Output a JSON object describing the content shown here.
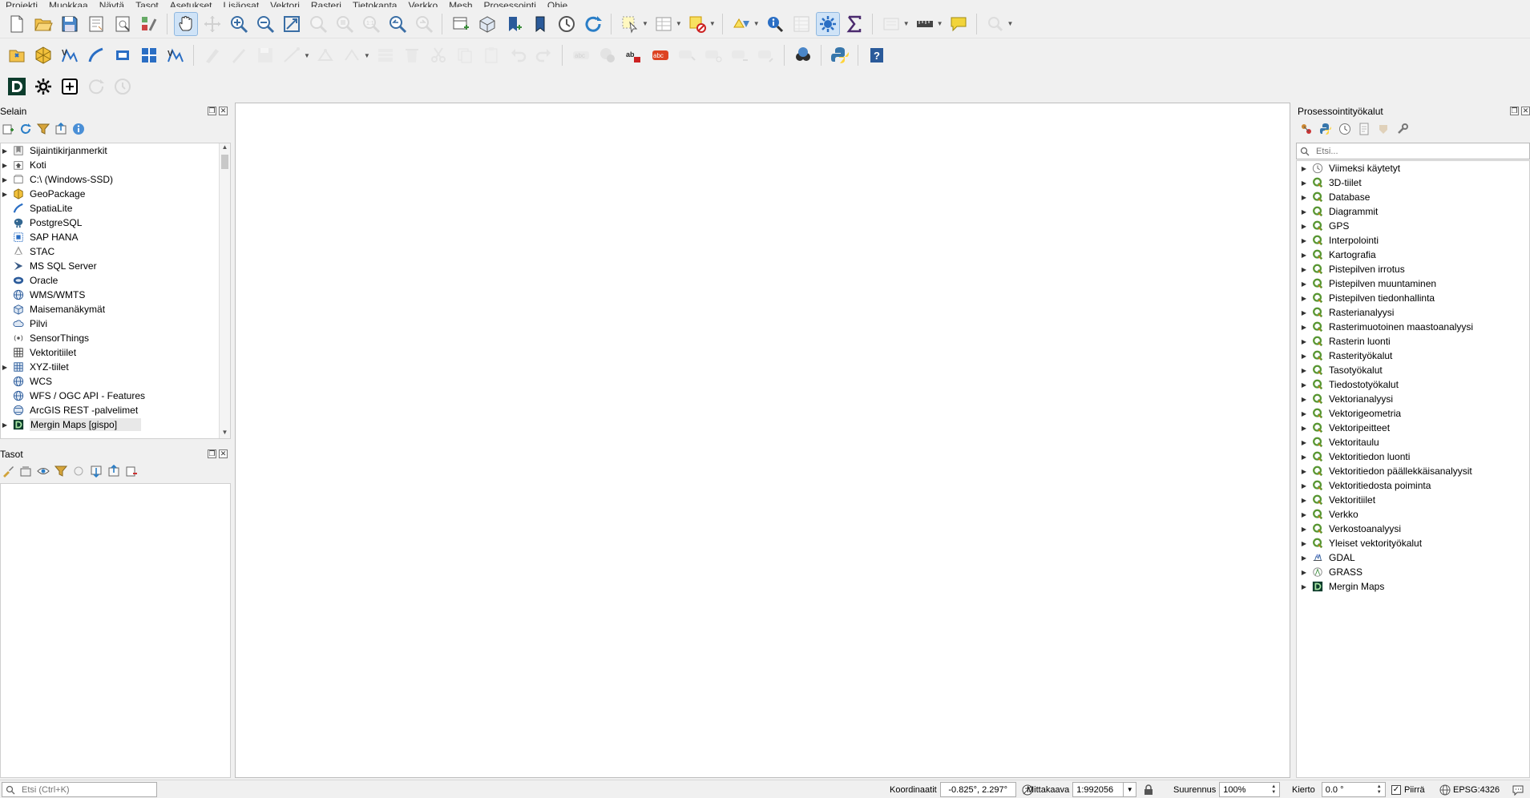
{
  "menubar": {
    "items": [
      "Projekti",
      "Muokkaa",
      "Näytä",
      "Tasot",
      "Asetukset",
      "Lisäosat",
      "Vektori",
      "Rasteri",
      "Tietokanta",
      "Verkko",
      "Mesh",
      "Prosessointi",
      "Ohje"
    ]
  },
  "toolbar1": {
    "icons": [
      "new-project-icon",
      "open-project-icon",
      "save-project-icon",
      "new-print-layout-icon",
      "layout-manager-icon",
      "style-manager-icon",
      "pan-icon",
      "pan-to-selection-icon",
      "zoom-in-icon",
      "zoom-out-icon",
      "zoom-full-icon",
      "zoom-to-selection-icon",
      "zoom-to-layer-icon",
      "zoom-native-icon",
      "zoom-last-icon",
      "zoom-next-icon",
      "new-map-view-icon",
      "new-3d-map-icon",
      "new-bookmark-icon",
      "show-bookmarks-icon",
      "temporal-controller-icon",
      "refresh-icon",
      "select-features-icon",
      "attribute-table-icon",
      "deselect-icon",
      "select-by-location-icon",
      "identify-icon",
      "statistics-icon",
      "processing-toolbox-icon",
      "sum-icon",
      "attribute-form-icon",
      "measure-icon",
      "map-tips-icon",
      "annotation-icon"
    ]
  },
  "toolbar2": {
    "icons": [
      "data-source-manager-icon",
      "new-geopackage-layer-icon",
      "new-shapefile-layer-icon",
      "new-spatialite-layer-icon",
      "new-temp-layer-icon",
      "new-virtual-layer-icon",
      "new-mesh-layer-icon",
      "digitize-icon",
      "edit-pencil-icon",
      "save-edits-icon",
      "add-feature-icon",
      "vertex-tool-icon",
      "multi-edit-icon",
      "modify-attributes-icon",
      "delete-selected-icon",
      "cut-features-icon",
      "copy-features-icon",
      "paste-features-icon",
      "undo-icon",
      "redo-icon",
      "label-toolbar-icon",
      "label-pin-icon",
      "label-highlight-icon",
      "label-show-hide-icon",
      "label-move-icon",
      "label-rotate-icon",
      "label-change-icon",
      "label-preview-icon",
      "georeferencer-icon",
      "python-console-icon",
      "help-icon"
    ]
  },
  "toolbar3": {
    "icons": [
      "mergin-maps-logo-icon",
      "settings-icon",
      "add-project-icon",
      "sync-icon",
      "history-icon"
    ]
  },
  "browser": {
    "title": "Selain",
    "items": [
      {
        "label": "Sijaintikirjanmerkit",
        "icon": "bookmarks-icon",
        "expandable": true
      },
      {
        "label": "Koti",
        "icon": "home-folder-icon",
        "expandable": true
      },
      {
        "label": "C:\\ (Windows-SSD)",
        "icon": "drive-icon",
        "expandable": true
      },
      {
        "label": "GeoPackage",
        "icon": "geopackage-icon",
        "expandable": true
      },
      {
        "label": "SpatiaLite",
        "icon": "spatialite-icon",
        "expandable": false
      },
      {
        "label": "PostgreSQL",
        "icon": "postgresql-icon",
        "expandable": false
      },
      {
        "label": "SAP HANA",
        "icon": "sap-hana-icon",
        "expandable": false
      },
      {
        "label": "STAC",
        "icon": "stac-icon",
        "expandable": false
      },
      {
        "label": "MS SQL Server",
        "icon": "mssql-icon",
        "expandable": false
      },
      {
        "label": "Oracle",
        "icon": "oracle-icon",
        "expandable": false
      },
      {
        "label": "WMS/WMTS",
        "icon": "wms-icon",
        "expandable": false
      },
      {
        "label": "Maisemanäkymät",
        "icon": "scene-icon",
        "expandable": false
      },
      {
        "label": "Pilvi",
        "icon": "cloud-icon",
        "expandable": false
      },
      {
        "label": "SensorThings",
        "icon": "sensorthings-icon",
        "expandable": false
      },
      {
        "label": "Vektoritiilet",
        "icon": "vector-tiles-icon",
        "expandable": false
      },
      {
        "label": "XYZ-tiilet",
        "icon": "xyz-tiles-icon",
        "expandable": true
      },
      {
        "label": "WCS",
        "icon": "wcs-icon",
        "expandable": false
      },
      {
        "label": "WFS / OGC API - Features",
        "icon": "wfs-icon",
        "expandable": false
      },
      {
        "label": "ArcGIS REST -palvelimet",
        "icon": "arcgis-icon",
        "expandable": false
      },
      {
        "label": "Mergin Maps [gispo]",
        "icon": "mergin-maps-icon",
        "expandable": true
      }
    ]
  },
  "layers": {
    "title": "Tasot"
  },
  "processing": {
    "title": "Prosessointityökalut",
    "search_placeholder": "Etsi...",
    "items": [
      {
        "label": "Viimeksi käytetyt",
        "icon": "clock-icon"
      },
      {
        "label": "3D-tiilet",
        "icon": "qgis-q-icon"
      },
      {
        "label": "Database",
        "icon": "qgis-q-icon"
      },
      {
        "label": "Diagrammit",
        "icon": "qgis-q-icon"
      },
      {
        "label": "GPS",
        "icon": "qgis-q-icon"
      },
      {
        "label": "Interpolointi",
        "icon": "qgis-q-icon"
      },
      {
        "label": "Kartografia",
        "icon": "qgis-q-icon"
      },
      {
        "label": "Pistepilven irrotus",
        "icon": "qgis-q-icon"
      },
      {
        "label": "Pistepilven muuntaminen",
        "icon": "qgis-q-icon"
      },
      {
        "label": "Pistepilven tiedonhallinta",
        "icon": "qgis-q-icon"
      },
      {
        "label": "Rasterianalyysi",
        "icon": "qgis-q-icon"
      },
      {
        "label": "Rasterimuotoinen maastoanalyysi",
        "icon": "qgis-q-icon"
      },
      {
        "label": "Rasterin luonti",
        "icon": "qgis-q-icon"
      },
      {
        "label": "Rasterityökalut",
        "icon": "qgis-q-icon"
      },
      {
        "label": "Tasotyökalut",
        "icon": "qgis-q-icon"
      },
      {
        "label": "Tiedostotyökalut",
        "icon": "qgis-q-icon"
      },
      {
        "label": "Vektorianalyysi",
        "icon": "qgis-q-icon"
      },
      {
        "label": "Vektorigeometria",
        "icon": "qgis-q-icon"
      },
      {
        "label": "Vektoripeitteet",
        "icon": "qgis-q-icon"
      },
      {
        "label": "Vektoritaulu",
        "icon": "qgis-q-icon"
      },
      {
        "label": "Vektoritiedon luonti",
        "icon": "qgis-q-icon"
      },
      {
        "label": "Vektoritiedon päällekkäisanalyysit",
        "icon": "qgis-q-icon"
      },
      {
        "label": "Vektoritiedosta poiminta",
        "icon": "qgis-q-icon"
      },
      {
        "label": "Vektoritiilet",
        "icon": "qgis-q-icon"
      },
      {
        "label": "Verkko",
        "icon": "qgis-q-icon"
      },
      {
        "label": "Verkostoanalyysi",
        "icon": "qgis-q-icon"
      },
      {
        "label": "Yleiset vektorityökalut",
        "icon": "qgis-q-icon"
      },
      {
        "label": "GDAL",
        "icon": "gdal-icon"
      },
      {
        "label": "GRASS",
        "icon": "grass-icon"
      },
      {
        "label": "Mergin Maps",
        "icon": "mergin-maps-icon"
      }
    ]
  },
  "statusbar": {
    "locator_placeholder": "Etsi (Ctrl+K)",
    "coordinates_label": "Koordinaatit",
    "coordinates_value": "-0.825°, 2.297°",
    "scale_label": "Mittakaava",
    "scale_value": "1:992056",
    "magnifier_label": "Suurennus",
    "magnifier_value": "100%",
    "rotation_label": "Kierto",
    "rotation_value": "0.0 °",
    "render_label": "Piirrä",
    "render_checked": true,
    "crs_label": "EPSG:4326"
  },
  "colors": {
    "qgis_green": "#589632",
    "accent_blue": "#1f6fbf",
    "active_tool_bg": "#cfe3f7"
  }
}
